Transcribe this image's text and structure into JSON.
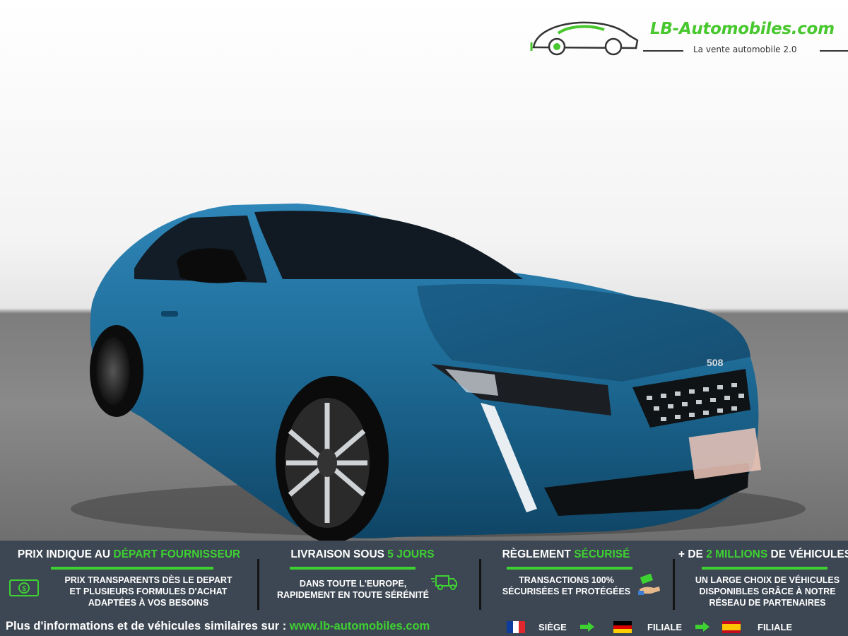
{
  "logo": {
    "name": "LB-Automobiles.com",
    "tagline": "La vente automobile 2.0"
  },
  "car": {
    "badge": "508"
  },
  "features": [
    {
      "title_pre": "PRIX INDIQUE AU ",
      "title_hl": "DÉPART FOURNISSEUR",
      "title_post": "",
      "lines": [
        "PRIX TRANSPARENTS DÈS LE DEPART",
        "ET PLUSIEURS FORMULES D'ACHAT",
        "ADAPTÉES À VOS BESOINS"
      ],
      "icon": "money-icon"
    },
    {
      "title_pre": "LIVRAISON SOUS ",
      "title_hl": "5 JOURS",
      "title_post": "",
      "lines": [
        "DANS TOUTE L'EUROPE,",
        "RAPIDEMENT EN TOUTE SÉRÉNITÉ"
      ],
      "icon": "delivery-truck-icon"
    },
    {
      "title_pre": "RÈGLEMENT ",
      "title_hl": "SÉCURISÉ",
      "title_post": "",
      "lines": [
        "TRANSACTIONS 100%",
        "SÉCURISÉES ET PROTÉGÉES"
      ],
      "icon": "payment-hand-icon"
    },
    {
      "title_pre": "+ DE ",
      "title_hl": "2 MILLIONS",
      "title_post": " DE VÉHICULES",
      "lines": [
        "UN LARGE CHOIX DE VÉHICULES",
        "DISPONIBLES GRÂCE À NOTRE",
        "RÉSEAU DE PARTENAIRES"
      ],
      "icon": ""
    }
  ],
  "footer": {
    "text": "Plus d'informations et de véhicules similaires sur : ",
    "url": "www.lb-automobiles.com",
    "locations": [
      {
        "flag": "france-flag-icon",
        "label": "SIÈGE"
      },
      {
        "flag": "germany-flag-icon",
        "label": "FILIALE"
      },
      {
        "flag": "spain-flag-icon",
        "label": "FILIALE"
      }
    ]
  },
  "colors": {
    "accent": "#3ed132",
    "banner": "#3d4753",
    "car_body": "#1f6f9a"
  }
}
